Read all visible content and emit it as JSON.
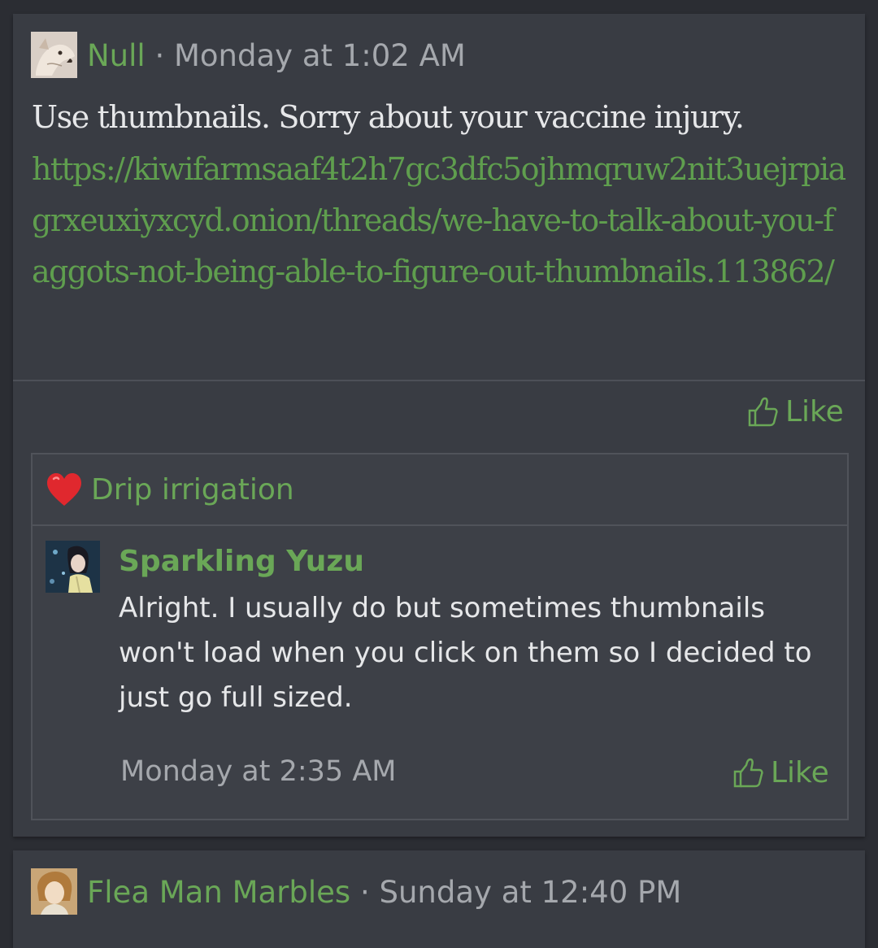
{
  "posts": [
    {
      "author": "Null",
      "separator": "·",
      "timestamp": "Monday at 1:02 AM",
      "body": "Use thumbnails. Sorry about your vaccine injury.",
      "link": "https://kiwifarmsaaf4t2h7gc3dfc5ojhmqruw2nit3uejrpiagrxeuxiyxcyd.onion/threads/we-have-to-talk-about-you-faggots-not-being-able-to-figure-out-thumbnails.113862/",
      "like_label": "Like",
      "reaction": {
        "icon": "heart-icon",
        "title": "Drip irrigation",
        "quote": {
          "author": "Sparkling Yuzu",
          "text": "Alright. I usually do but sometimes thumbnails won't load when you click on them so I decided to just go full sized.",
          "timestamp": "Monday at 2:35 AM",
          "like_label": "Like"
        }
      }
    },
    {
      "author": "Flea Man Marbles",
      "separator": "·",
      "timestamp": "Sunday at 12:40 PM"
    }
  ],
  "colors": {
    "background": "#2b2d33",
    "card": "#393c43",
    "accent_green": "#6aa757",
    "meta_gray": "#a5a8ad",
    "text": "#e6e7e9",
    "heart_red": "#e0282e"
  }
}
